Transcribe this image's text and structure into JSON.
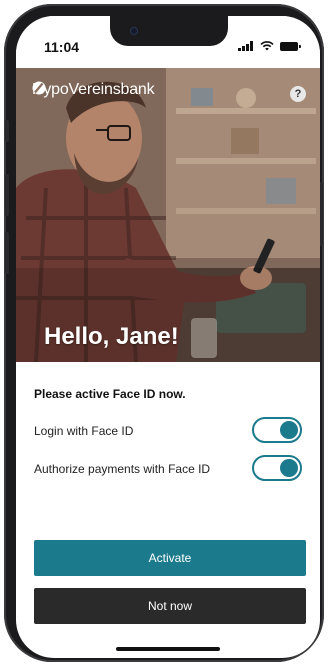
{
  "status_bar": {
    "time": "11:04"
  },
  "header": {
    "brand": "HypoVereinsbank",
    "help_icon": "?"
  },
  "hero": {
    "greeting": "Hello, Jane!"
  },
  "face_id": {
    "prompt": "Please active Face ID now.",
    "options": [
      {
        "label": "Login with Face ID",
        "enabled": true
      },
      {
        "label": "Authorize payments with Face ID",
        "enabled": true
      }
    ]
  },
  "actions": {
    "activate": "Activate",
    "not_now": "Not now"
  },
  "colors": {
    "accent": "#1b7a8c",
    "secondary_button": "#2a2a2a"
  }
}
